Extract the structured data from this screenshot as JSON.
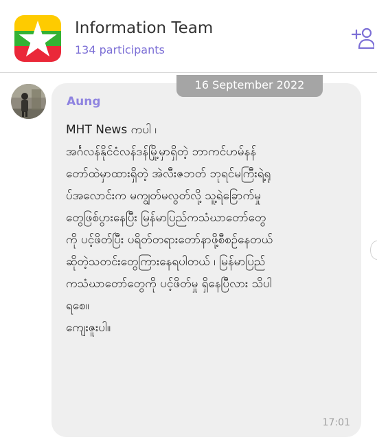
{
  "header": {
    "title": "Information Team",
    "participants": "134 participants"
  },
  "colors": {
    "accent": "#7c6fd6",
    "sender_name": "#8f84e0",
    "flag_yellow": "#fecb00",
    "flag_green": "#34b233",
    "flag_red": "#ea2839",
    "bubble": "#efefef",
    "date_pill": "#a5a5a5"
  },
  "icons": {
    "add_user": "add-user-icon",
    "group_avatar": "myanmar-flag-icon"
  },
  "chat": {
    "date": "16 September 2022",
    "message": {
      "sender": "Aung",
      "lines": [
        "MHT News ကပါ ၊",
        "အင်္ဂလန်နိုင်ငံလန်ဒန်မြို့မှာရှိတဲ့ ဘာကင်ဟမ်နန်",
        "တော်ထဲမှာထားရှိတဲ့ အဲလီးဇဘတ် ဘုရင်မကြီးရဲ့ရု",
        "ပ်အလောင်းက မကျွတ်မလွတ်လို့ သူ့ရဲခြောက်မှု",
        "တွေဖြစ်ပွားနေပြီး မြန်မာပြည်ကသံဃာတော်တွေ",
        "ကို ပင့်ဖိတ်ပြီး ပရိတ်တရားတော်နာဖို့စီစဉ်နေတယ်",
        "ဆိုတဲ့သတင်းတွေကြားနေရပါတယ် ၊ မြန်မာပြည်",
        "ကသံဃာတော်တွေကို ပင့်ဖိတ်မှု ရှိနေပြီလား သိပါ",
        "ရစေ။",
        "ကျေးဇူးပါ။"
      ],
      "time": "17:01"
    }
  }
}
